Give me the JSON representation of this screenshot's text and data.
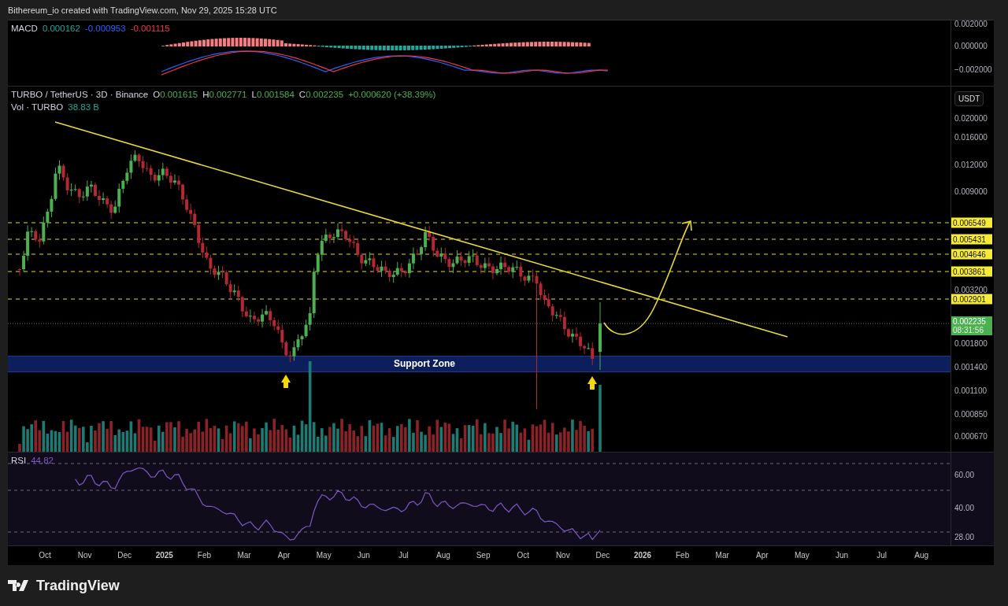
{
  "header": {
    "text": "Bithereum_io created with TradingView.com, Nov 29, 2025 15:28 UTC"
  },
  "macd": {
    "label": "MACD",
    "values": [
      {
        "text": "0.000162",
        "color": "#26a69a"
      },
      {
        "text": "-0.000953",
        "color": "#2962ff"
      },
      {
        "text": "-0.001115",
        "color": "#f23645"
      }
    ],
    "axis": [
      "0.002000",
      "0.000000",
      "−0.002000"
    ]
  },
  "main": {
    "legend": {
      "symbol": "TURBO / TetherUS · 3D · Binance",
      "ohlc": [
        {
          "key": "O",
          "value": "0.001615"
        },
        {
          "key": "H",
          "value": "0.002771"
        },
        {
          "key": "L",
          "value": "0.001584"
        },
        {
          "key": "C",
          "value": "0.002235"
        }
      ],
      "change": "+0.000620 (+38.39%)"
    },
    "volume": {
      "label": "Vol · TURBO",
      "value": "38.83 B"
    },
    "currency": "USDT",
    "axis": [
      "0.020000",
      "0.016000",
      "0.012000",
      "0.009000",
      "0.003200",
      "0.001800",
      "0.001400",
      "0.001100",
      "0.000850",
      "0.000670"
    ],
    "levels": [
      {
        "price": "0.006549"
      },
      {
        "price": "0.005431"
      },
      {
        "price": "0.004646"
      },
      {
        "price": "0.003861"
      },
      {
        "price": "0.002901"
      }
    ],
    "last_price": {
      "price": "0.002235",
      "countdown": "08:31:56"
    },
    "support_zone": {
      "label": "Support Zone"
    }
  },
  "rsi": {
    "label": "RSI",
    "value": "44.82",
    "axis": [
      "60.00",
      "40.00",
      "28.00"
    ]
  },
  "time_axis": [
    {
      "label": "Oct",
      "kind": "month"
    },
    {
      "label": "Nov",
      "kind": "month"
    },
    {
      "label": "Dec",
      "kind": "month"
    },
    {
      "label": "2025",
      "kind": "year"
    },
    {
      "label": "Feb",
      "kind": "month"
    },
    {
      "label": "Mar",
      "kind": "month"
    },
    {
      "label": "Apr",
      "kind": "month"
    },
    {
      "label": "May",
      "kind": "month"
    },
    {
      "label": "Jun",
      "kind": "month"
    },
    {
      "label": "Jul",
      "kind": "month"
    },
    {
      "label": "Aug",
      "kind": "month"
    },
    {
      "label": "Sep",
      "kind": "month"
    },
    {
      "label": "Oct",
      "kind": "month"
    },
    {
      "label": "Nov",
      "kind": "month"
    },
    {
      "label": "Dec",
      "kind": "month"
    },
    {
      "label": "2026",
      "kind": "year"
    },
    {
      "label": "Feb",
      "kind": "month"
    },
    {
      "label": "Mar",
      "kind": "month"
    },
    {
      "label": "Apr",
      "kind": "month"
    },
    {
      "label": "May",
      "kind": "month"
    },
    {
      "label": "Jun",
      "kind": "month"
    },
    {
      "label": "Jul",
      "kind": "month"
    },
    {
      "label": "Aug",
      "kind": "month"
    }
  ],
  "footer": {
    "brand": "TradingView"
  }
}
